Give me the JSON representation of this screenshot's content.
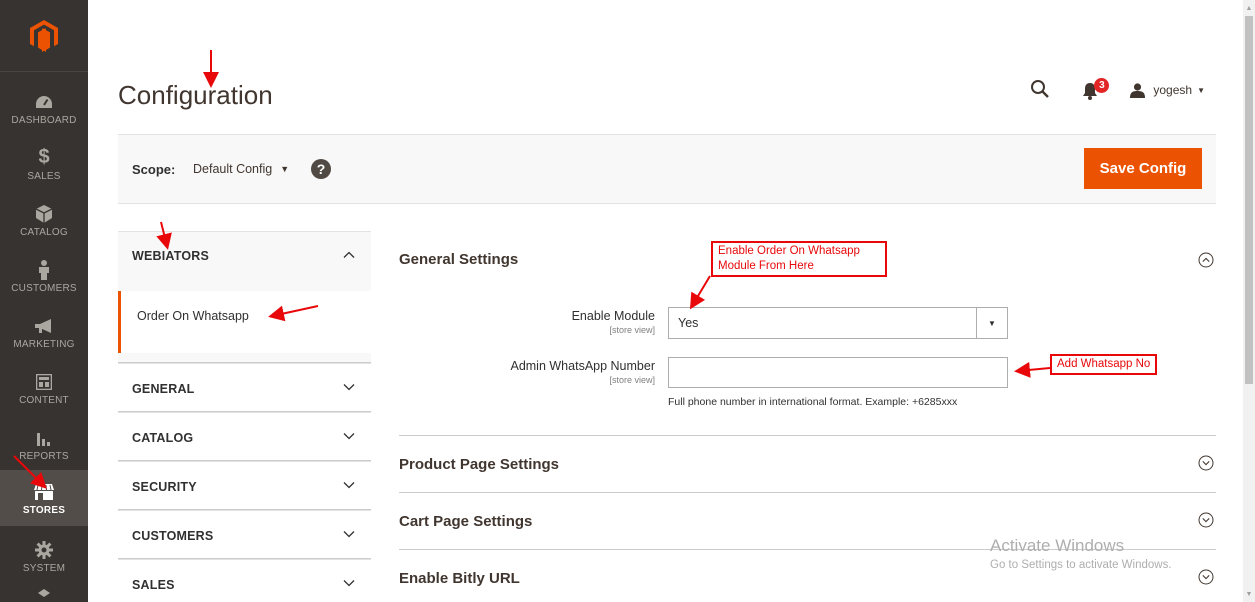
{
  "admin_menu": {
    "items": [
      {
        "label": "DASHBOARD",
        "icon": "dashboard-icon"
      },
      {
        "label": "SALES",
        "icon": "dollar-icon"
      },
      {
        "label": "CATALOG",
        "icon": "box-icon"
      },
      {
        "label": "CUSTOMERS",
        "icon": "person-icon"
      },
      {
        "label": "MARKETING",
        "icon": "megaphone-icon"
      },
      {
        "label": "CONTENT",
        "icon": "layout-icon"
      },
      {
        "label": "REPORTS",
        "icon": "bar-chart-icon"
      },
      {
        "label": "STORES",
        "icon": "storefront-icon"
      },
      {
        "label": "SYSTEM",
        "icon": "gear-icon"
      }
    ],
    "active": "STORES"
  },
  "header": {
    "title": "Configuration",
    "notifications_count": "3",
    "username": "yogesh"
  },
  "scope": {
    "label": "Scope:",
    "value": "Default Config",
    "help": "?",
    "save_label": "Save Config"
  },
  "config_nav": {
    "sections": [
      {
        "title": "WEBIATORS",
        "open": true,
        "items": [
          "Order On Whatsapp"
        ]
      },
      {
        "title": "GENERAL",
        "open": false
      },
      {
        "title": "CATALOG",
        "open": false
      },
      {
        "title": "SECURITY",
        "open": false
      },
      {
        "title": "CUSTOMERS",
        "open": false
      },
      {
        "title": "SALES",
        "open": false
      }
    ]
  },
  "config_main": {
    "groups": [
      {
        "title": "General Settings",
        "open": true,
        "fields": [
          {
            "label": "Enable Module",
            "scope": "[store view]",
            "type": "select",
            "value": "Yes"
          },
          {
            "label": "Admin WhatsApp Number",
            "scope": "[store view]",
            "type": "text",
            "value": "",
            "note": "Full phone number in international format. Example: +6285xxx"
          }
        ]
      },
      {
        "title": "Product Page Settings",
        "open": false
      },
      {
        "title": "Cart Page Settings",
        "open": false
      },
      {
        "title": "Enable Bitly URL",
        "open": false
      }
    ]
  },
  "annotations": {
    "enable_module_note": [
      "Enable Order On Whatsapp",
      "Module From Here"
    ],
    "whatsapp_note": "Add Whatsapp No"
  },
  "watermark": {
    "line1": "Activate Windows",
    "line2": "Go to Settings to activate Windows."
  },
  "colors": {
    "menu_bg": "#373330",
    "accent": "#eb5202",
    "annotation": "#e8080a"
  }
}
